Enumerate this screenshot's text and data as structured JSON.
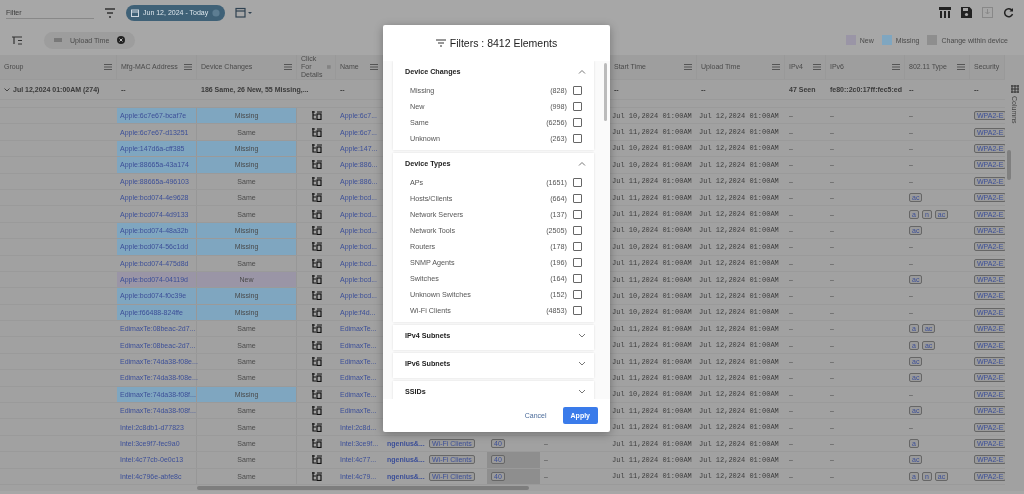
{
  "toolbar": {
    "filter": {
      "placeholder": "Filter"
    },
    "date_chip": "Jun 12, 2024 - Today"
  },
  "group_bar": {
    "chip": "Upload Time"
  },
  "legend": [
    {
      "label": "New",
      "color": "#9a95a6"
    },
    {
      "label": "Missing",
      "color": "#7fa6c0"
    },
    {
      "label": "Change within device",
      "color": "#8e8e8e"
    }
  ],
  "table": {
    "columns": [
      "Group",
      "Mfg-MAC Address",
      "Device Changes",
      "Click For Details",
      "Name",
      "",
      "",
      "",
      "",
      "Start Time",
      "Upload Time",
      "IPv4",
      "IPv6",
      "802.11 Type",
      "Security"
    ],
    "group_row": {
      "label": "Jul 12,2024 01:00AM (274)",
      "mac": "--",
      "changes": "186 Same, 26 New, 55 Missing,...",
      "name": "--",
      "start": "--",
      "upload": "--",
      "ipv4": "47 Seen",
      "ipv6": "fe80::2c0:17ff:fec5:ed",
      "type": "--",
      "security": "--"
    },
    "rows": [
      {
        "mac": "Apple:6c7e67-bcaf7e",
        "change": "Missing",
        "color": "#7fa6c0",
        "name": "Apple:6c7...",
        "start": "Jul 10,2024 01:00AM",
        "upload": "Jul 12,2024 01:00AM",
        "ipv4": "–",
        "ipv6": "–",
        "type": "–",
        "security": "WPA2-E"
      },
      {
        "mac": "Apple:6c7e67-d13251",
        "change": "Same",
        "name": "Apple:6c7...",
        "start": "Jul 11,2024 01:00AM",
        "upload": "Jul 12,2024 01:00AM",
        "ipv4": "–",
        "ipv6": "–",
        "type": "–",
        "security": "WPA2-E"
      },
      {
        "mac": "Apple:147d6a-cff385",
        "change": "Missing",
        "color": "#7fa6c0",
        "name": "Apple:147...",
        "start": "Jul 10,2024 01:00AM",
        "upload": "Jul 12,2024 01:00AM",
        "ipv4": "–",
        "ipv6": "–",
        "type": "–",
        "security": "WPA2-E"
      },
      {
        "mac": "Apple:88665a-43a174",
        "change": "Missing",
        "color": "#7fa6c0",
        "name": "Apple:886...",
        "start": "Jul 10,2024 01:00AM",
        "upload": "Jul 12,2024 01:00AM",
        "ipv4": "–",
        "ipv6": "–",
        "type": "–",
        "security": "WPA2-E"
      },
      {
        "mac": "Apple:88665a-496103",
        "change": "Same",
        "name": "Apple:886...",
        "start": "Jul 11,2024 01:00AM",
        "upload": "Jul 12,2024 01:00AM",
        "ipv4": "–",
        "ipv6": "–",
        "type": "–",
        "security": "WPA2-E"
      },
      {
        "mac": "Apple:bcd074-4e9628",
        "change": "Same",
        "name": "Apple:bcd...",
        "start": "Jul 11,2024 01:00AM",
        "upload": "Jul 12,2024 01:00AM",
        "ipv4": "–",
        "ipv6": "–",
        "types": [
          "ac"
        ],
        "security": "WPA2-E"
      },
      {
        "mac": "Apple:bcd074-4d9133",
        "change": "Same",
        "name": "Apple:bcd...",
        "start": "Jul 11,2024 01:00AM",
        "upload": "Jul 12,2024 01:00AM",
        "ipv4": "–",
        "ipv6": "–",
        "types": [
          "a",
          "n",
          "ac"
        ],
        "security": "WPA2-E"
      },
      {
        "mac": "Apple:bcd074-48a32b",
        "change": "Missing",
        "color": "#7fa6c0",
        "name": "Apple:bcd...",
        "start": "Jul 10,2024 01:00AM",
        "upload": "Jul 12,2024 01:00AM",
        "ipv4": "–",
        "ipv6": "–",
        "types": [
          "ac"
        ],
        "security": "WPA2-E"
      },
      {
        "mac": "Apple:bcd074-56c1dd",
        "change": "Missing",
        "color": "#7fa6c0",
        "name": "Apple:bcd...",
        "start": "Jul 10,2024 01:00AM",
        "upload": "Jul 12,2024 01:00AM",
        "ipv4": "–",
        "ipv6": "–",
        "type": "–",
        "security": "WPA2-E"
      },
      {
        "mac": "Apple:bcd074-475d8d",
        "change": "Same",
        "name": "Apple:bcd...",
        "start": "Jul 11,2024 01:00AM",
        "upload": "Jul 12,2024 01:00AM",
        "ipv4": "–",
        "ipv6": "–",
        "type": "–",
        "security": "WPA2-E"
      },
      {
        "mac": "Apple:bcd074-04119d",
        "change": "New",
        "color": "#9a95a6",
        "name": "Apple:bcd...",
        "start": "Jul 11,2024 01:00AM",
        "upload": "Jul 12,2024 01:00AM",
        "ipv4": "–",
        "ipv6": "–",
        "types": [
          "ac"
        ],
        "security": "WPA2-E"
      },
      {
        "mac": "Apple:bcd074-f0c39e",
        "change": "Missing",
        "color": "#7fa6c0",
        "name": "Apple:bcd...",
        "start": "Jul 10,2024 01:00AM",
        "upload": "Jul 12,2024 01:00AM",
        "ipv4": "–",
        "ipv6": "–",
        "type": "–",
        "security": "WPA2-E"
      },
      {
        "mac": "Apple:f66488-824ffe",
        "change": "Missing",
        "color": "#7fa6c0",
        "name": "Apple:f4d...",
        "start": "Jul 10,2024 01:00AM",
        "upload": "Jul 12,2024 01:00AM",
        "ipv4": "–",
        "ipv6": "–",
        "type": "–",
        "security": "WPA2-E"
      },
      {
        "mac": "EdimaxTe:08beac-2d7...",
        "change": "Same",
        "name": "EdimaxTe...",
        "start": "Jul 11,2024 01:00AM",
        "upload": "Jul 12,2024 01:00AM",
        "ipv4": "–",
        "ipv6": "–",
        "types": [
          "a",
          "ac"
        ],
        "security": "WPA2-E"
      },
      {
        "mac": "EdimaxTe:08beac-2d7...",
        "change": "Same",
        "name": "EdimaxTe...",
        "start": "Jul 11,2024 01:00AM",
        "upload": "Jul 12,2024 01:00AM",
        "ipv4": "–",
        "ipv6": "–",
        "types": [
          "a",
          "ac"
        ],
        "security": "WPA2-E"
      },
      {
        "mac": "EdimaxTe:74da38-f08e...",
        "change": "Same",
        "name": "EdimaxTe...",
        "start": "Jul 11,2024 01:00AM",
        "upload": "Jul 12,2024 01:00AM",
        "ipv4": "–",
        "ipv6": "–",
        "types": [
          "ac"
        ],
        "security": "WPA2-E"
      },
      {
        "mac": "EdimaxTe:74da38-f08e...",
        "change": "Same",
        "name": "EdimaxTe...",
        "start": "Jul 11,2024 01:00AM",
        "upload": "Jul 12,2024 01:00AM",
        "ipv4": "–",
        "ipv6": "–",
        "types": [
          "ac"
        ],
        "security": "WPA2-E"
      },
      {
        "mac": "EdimaxTe:74da38-f08f...",
        "change": "Missing",
        "color": "#7fa6c0",
        "name": "EdimaxTe...",
        "start": "Jul 10,2024 01:00AM",
        "upload": "Jul 12,2024 01:00AM",
        "ipv4": "–",
        "ipv6": "–",
        "type": "–",
        "security": "WPA2-E"
      },
      {
        "mac": "EdimaxTe:74da38-f08f...",
        "change": "Same",
        "name": "EdimaxTe...",
        "start": "Jul 11,2024 01:00AM",
        "upload": "Jul 12,2024 01:00AM",
        "ipv4": "–",
        "ipv6": "–",
        "types": [
          "ac"
        ],
        "security": "WPA2-E"
      },
      {
        "mac": "Intel:2c8db1-d77823",
        "change": "Same",
        "name": "Intel:2c8d...",
        "start": "Jul 11,2024 01:00AM",
        "upload": "Jul 12,2024 01:00AM",
        "ipv4": "–",
        "ipv6": "–",
        "type": "–",
        "security": "WPA2-E"
      },
      {
        "mac": "Intel:3ce9f7-fec9a0",
        "change": "Same",
        "name": "Intel:3ce9f...",
        "column_6": "ngenius&...",
        "device_type": "Wi-Fi Clients",
        "column_8": "40",
        "column_8_changed": false,
        "column_9": "–",
        "start": "Jul 11,2024 01:00AM",
        "upload": "Jul 12,2024 01:00AM",
        "ipv4": "–",
        "ipv6": "–",
        "types": [
          "a"
        ],
        "security": "WPA2-E"
      },
      {
        "mac": "Intel:4c77cb-0e0c13",
        "change": "Same",
        "name": "Intel:4c77...",
        "column_6": "ngenius&...",
        "device_type": "Wi-Fi Clients",
        "column_8": "40",
        "column_8_changed": true,
        "column_9": "–",
        "start": "Jul 11,2024 01:00AM",
        "upload": "Jul 12,2024 01:00AM",
        "ipv4": "–",
        "ipv6": "–",
        "types": [
          "ac"
        ],
        "security": "WPA2-E"
      },
      {
        "mac": "Intel:4c796e-abfe8c",
        "change": "Same",
        "name": "Intel:4c79...",
        "column_6": "ngenius&...",
        "device_type": "Wi-Fi Clients",
        "column_8": "40",
        "column_8_changed": true,
        "column_9": "–",
        "start": "Jul 11,2024 01:00AM",
        "upload": "Jul 12,2024 01:00AM",
        "ipv4": "–",
        "ipv6": "–",
        "types": [
          "a",
          "n",
          "ac"
        ],
        "security": "WPA2-E"
      }
    ]
  },
  "columns_tab": "Columns",
  "dialog": {
    "title": "Filters : 8412 Elements",
    "sections": [
      {
        "title": "Device Changes",
        "expanded": true,
        "items": [
          {
            "label": "Missing",
            "count": "(828)",
            "checked": false
          },
          {
            "label": "New",
            "count": "(998)",
            "checked": false
          },
          {
            "label": "Same",
            "count": "(6256)",
            "checked": false
          },
          {
            "label": "Unknown",
            "count": "(263)",
            "checked": false
          }
        ]
      },
      {
        "title": "Device Types",
        "expanded": true,
        "items": [
          {
            "label": "APs",
            "count": "(1651)",
            "checked": false
          },
          {
            "label": "Hosts/Clients",
            "count": "(664)",
            "checked": false
          },
          {
            "label": "Network Servers",
            "count": "(137)",
            "checked": false
          },
          {
            "label": "Network Tools",
            "count": "(2505)",
            "checked": false
          },
          {
            "label": "Routers",
            "count": "(178)",
            "checked": false
          },
          {
            "label": "SNMP Agents",
            "count": "(196)",
            "checked": false
          },
          {
            "label": "Switches",
            "count": "(164)",
            "checked": false
          },
          {
            "label": "Unknown Switches",
            "count": "(152)",
            "checked": false
          },
          {
            "label": "Wi-Fi Clients",
            "count": "(4853)",
            "checked": false
          }
        ]
      },
      {
        "title": "IPv4 Subnets",
        "expanded": false
      },
      {
        "title": "IPv6 Subnets",
        "expanded": false
      },
      {
        "title": "SSIDs",
        "expanded": false
      }
    ],
    "buttons": [
      "Cancel",
      "Apply"
    ]
  }
}
